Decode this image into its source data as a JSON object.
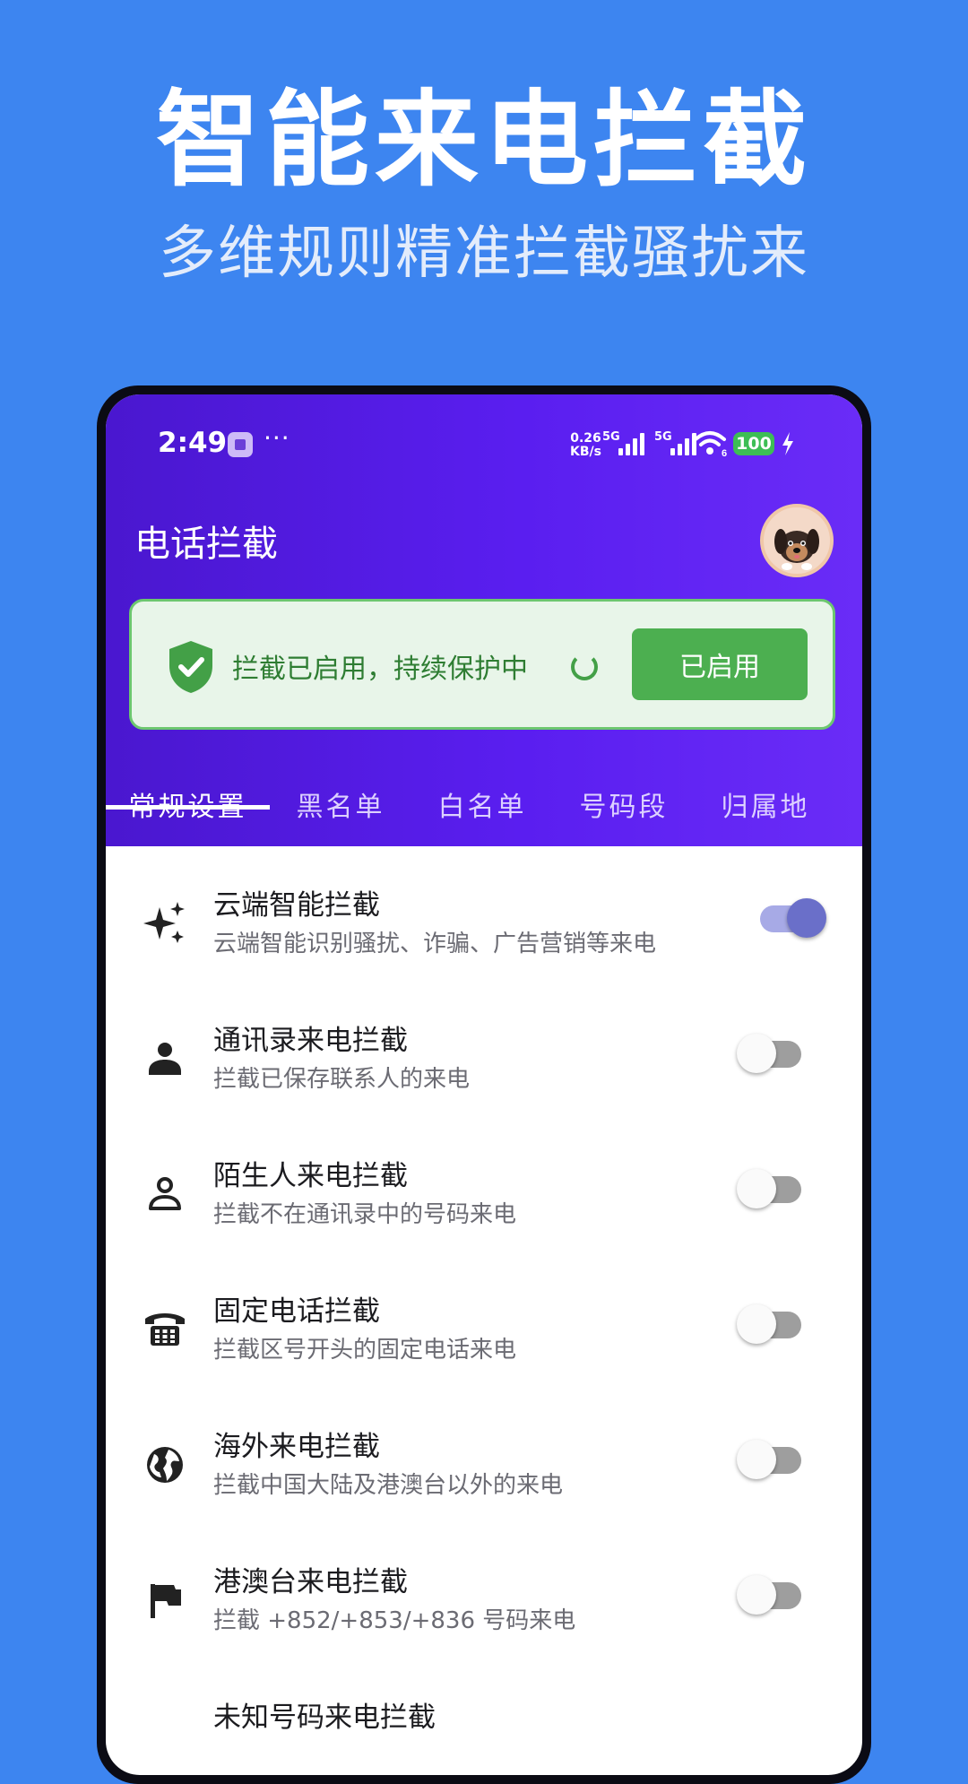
{
  "promo": {
    "title": "智能来电拦截",
    "subtitle": "多维规则精准拦截骚扰来"
  },
  "status_bar": {
    "time": "2:49",
    "more": "···",
    "net_speed_value": "0.26",
    "net_speed_unit": "KB/s",
    "sim1_label": "5G",
    "sim2_label": "5G",
    "wifi_badge": "6",
    "battery": "100"
  },
  "app": {
    "title": "电话拦截",
    "status_message": "拦截已启用，持续保护中",
    "enable_button_label": "已启用"
  },
  "tabs": [
    "常规设置",
    "黑名单",
    "白名单",
    "号码段",
    "归属地"
  ],
  "active_tab": 0,
  "settings": [
    {
      "icon": "sparkle-icon",
      "title": "云端智能拦截",
      "desc": "云端智能识别骚扰、诈骗、广告营销等来电",
      "enabled": true
    },
    {
      "icon": "person-icon",
      "title": "通讯录来电拦截",
      "desc": "拦截已保存联系人的来电",
      "enabled": false
    },
    {
      "icon": "person-outline-icon",
      "title": "陌生人来电拦截",
      "desc": "拦截不在通讯录中的号码来电",
      "enabled": false
    },
    {
      "icon": "landline-phone-icon",
      "title": "固定电话拦截",
      "desc": "拦截区号开头的固定电话来电",
      "enabled": false
    },
    {
      "icon": "globe-icon",
      "title": "海外来电拦截",
      "desc": "拦截中国大陆及港澳台以外的来电",
      "enabled": false
    },
    {
      "icon": "flag-icon",
      "title": "港澳台来电拦截",
      "desc": "拦截 +852/+853/+836 号码来电",
      "enabled": false
    },
    {
      "icon": "",
      "title": "未知号码来电拦截",
      "desc": "",
      "enabled": false
    }
  ],
  "colors": {
    "background": "#3d85f0",
    "header_gradient_start": "#4a17cf",
    "header_gradient_end": "#6a2cf7",
    "status_green": "#2e7d32",
    "button_green": "#4caf50",
    "switch_on": "#6a6fc9"
  }
}
